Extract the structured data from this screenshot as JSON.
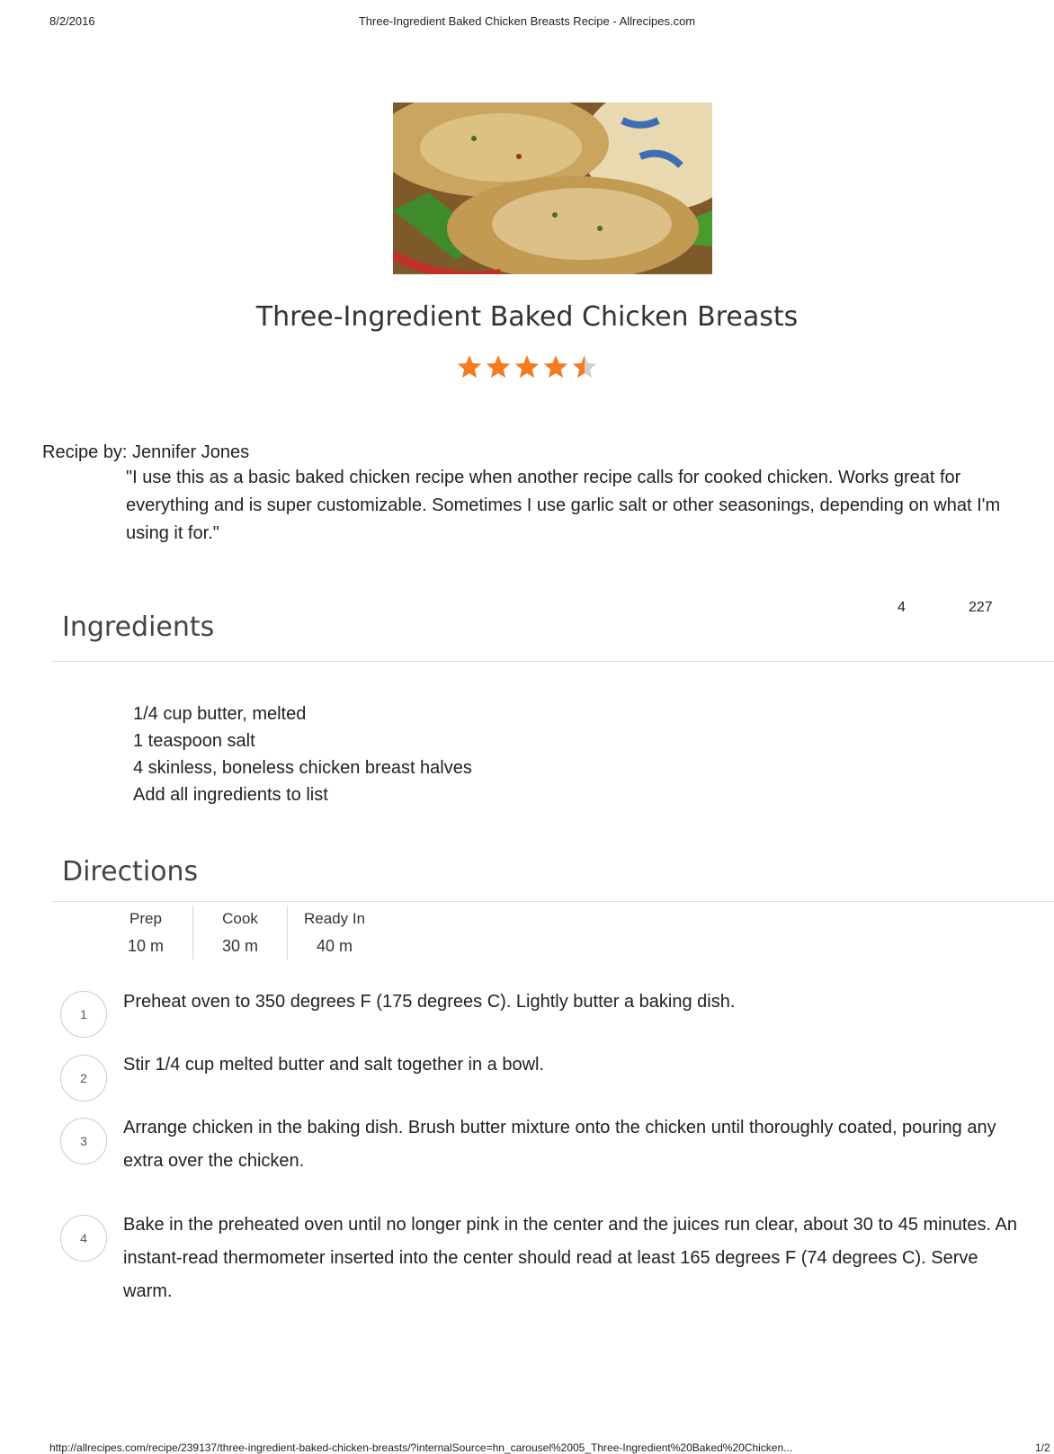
{
  "header": {
    "date": "8/2/2016",
    "title": "Three-Ingredient Baked Chicken Breasts Recipe - Allrecipes.com"
  },
  "recipe": {
    "photo_alt": "Three-Ingredient Baked Chicken Breasts",
    "title": "Three-Ingredient Baked Chicken Breasts",
    "rating": 4.5,
    "rating_max": 5,
    "star_color": "#f47b20",
    "star_empty_color": "#cfcfcf",
    "recipe_by": "Recipe by: Jennifer Jones",
    "description": "\"I use this as a basic baked chicken recipe when another recipe calls for cooked chicken. Works great for everything and is super customizable. Sometimes I use garlic salt or other seasonings, depending on what I'm using it for.\""
  },
  "ingredients": {
    "heading": "Ingredients",
    "servings": "4",
    "calories": "227",
    "items": [
      "1/4 cup butter, melted",
      "1 teaspoon salt",
      "4 skinless, boneless chicken breast halves",
      "Add all ingredients to list"
    ]
  },
  "directions": {
    "heading": "Directions",
    "times": [
      {
        "label": "Prep",
        "value": "10 m"
      },
      {
        "label": "Cook",
        "value": "30 m"
      },
      {
        "label": "Ready In",
        "value": "40 m"
      }
    ],
    "steps": [
      {
        "num": "1",
        "text": "Preheat oven to 350 degrees F (175 degrees C). Lightly butter a baking dish."
      },
      {
        "num": "2",
        "text": "Stir 1/4 cup melted butter and salt together in a bowl."
      },
      {
        "num": "3",
        "text": "Arrange chicken in the baking dish. Brush butter mixture onto the chicken until thoroughly coated, pouring any extra over the chicken."
      },
      {
        "num": "4",
        "text": "Bake in the preheated oven until no longer pink in the center and the juices run clear, about 30 to 45 minutes. An instant-read thermometer inserted into the center should read at least 165 degrees F (74 degrees C). Serve warm."
      }
    ]
  },
  "footer": {
    "url": "http://allrecipes.com/recipe/239137/three-ingredient-baked-chicken-breasts/?internalSource=hn_carousel%2005_Three-Ingredient%20Baked%20Chicken...",
    "page": "1/2"
  }
}
